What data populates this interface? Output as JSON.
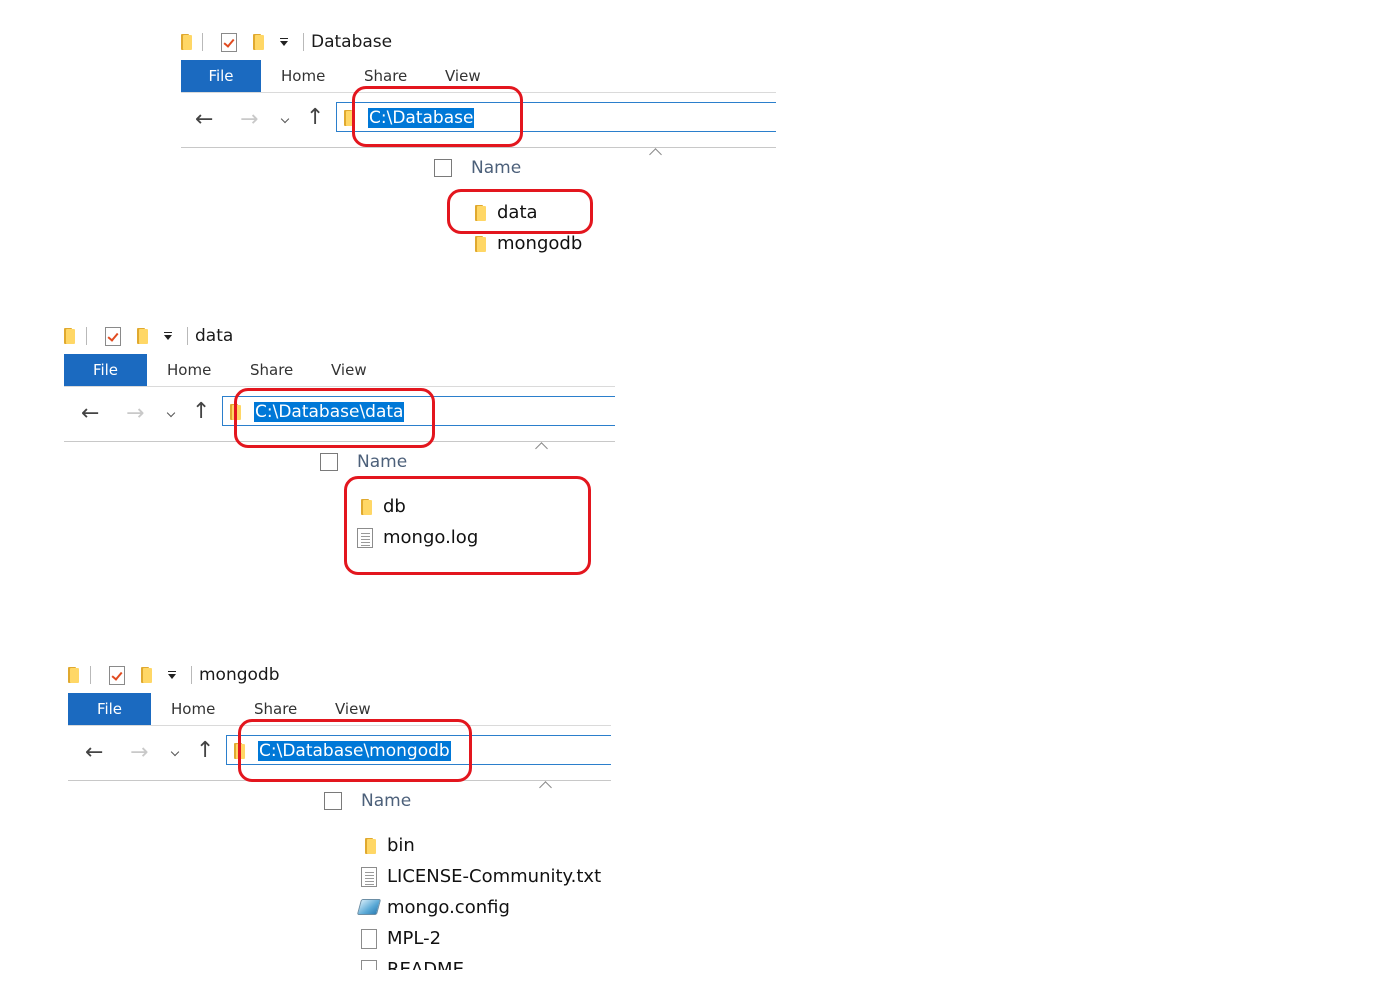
{
  "ribbon": {
    "file": "File",
    "home": "Home",
    "share": "Share",
    "view": "View"
  },
  "column_header": "Name",
  "highlight_color": "#e3161e",
  "windows": [
    {
      "title": "Database",
      "address": "C:\\Database",
      "files": [
        {
          "name": "data",
          "icon": "folder-icon"
        },
        {
          "name": "mongodb",
          "icon": "folder-icon"
        }
      ]
    },
    {
      "title": "data",
      "address": "C:\\Database\\data",
      "files": [
        {
          "name": "db",
          "icon": "folder-icon"
        },
        {
          "name": "mongo.log",
          "icon": "text-file-icon"
        }
      ]
    },
    {
      "title": "mongodb",
      "address": "C:\\Database\\mongodb",
      "files": [
        {
          "name": "bin",
          "icon": "folder-icon"
        },
        {
          "name": "LICENSE-Community.txt",
          "icon": "text-file-icon"
        },
        {
          "name": "mongo.config",
          "icon": "config-file-icon"
        },
        {
          "name": "MPL-2",
          "icon": "blank-file-icon"
        },
        {
          "name": "README",
          "icon": "blank-file-icon"
        }
      ]
    }
  ]
}
